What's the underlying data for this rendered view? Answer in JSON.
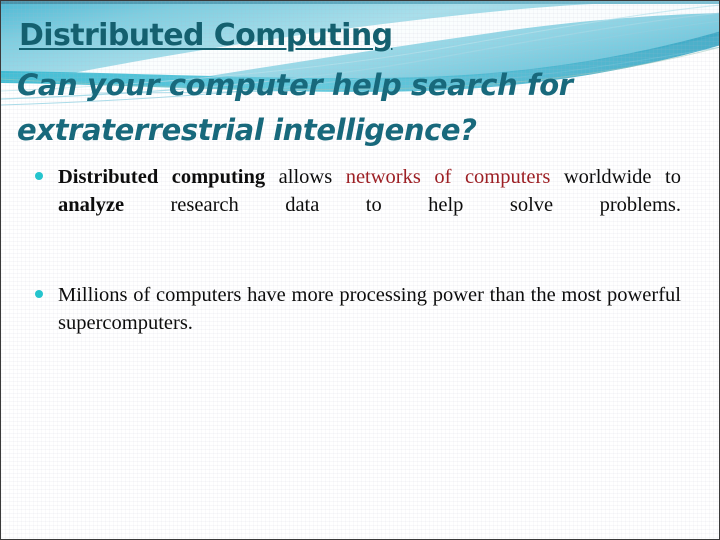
{
  "slide": {
    "title": "Distributed Computing",
    "subtitle_line_1": "Can your computer help search for",
    "subtitle_line_2": "extraterrestrial intelligence?",
    "bullets": [
      {
        "segments": {
          "lead_bold": "Distributed computing",
          "after_lead": " allows ",
          "highlight_red": "networks of computers",
          "middle": " worldwide to ",
          "emphasis_bold": "analyze",
          "tail": " research data to help solve problems."
        }
      },
      {
        "segments": {
          "plain": "Millions of computers have more processing power than the most powerful supercomputers."
        }
      }
    ],
    "colors": {
      "title": "#14606f",
      "subtitle": "#18697c",
      "bullet_dot": "#25c4cd",
      "highlight_red": "#9d2025",
      "body_text": "#0d0d0d",
      "banner_cyan_dark": "#3fb6cf",
      "banner_cyan_light": "#bfe6ee",
      "banner_top_edge": "#4a93aa",
      "slide_border": "#3a3a3a",
      "background": "#ffffff"
    },
    "decorations": {
      "banner_icon": "wave-swoosh-graphic"
    }
  }
}
